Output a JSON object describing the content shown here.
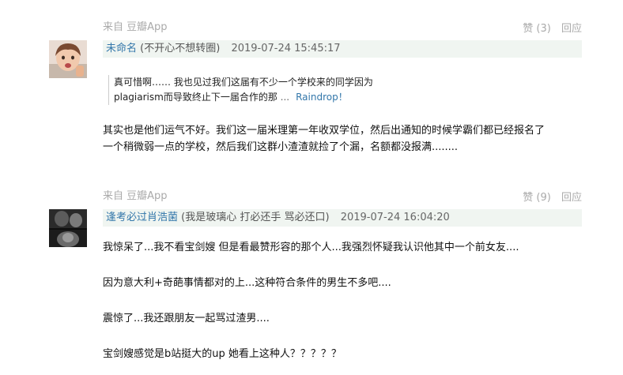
{
  "comments": [
    {
      "source": "来自 豆瓣App",
      "like_label": "赞 (3)",
      "reply_label": "回应",
      "author": "未命名",
      "author_sign": "(不开心不想转圈)",
      "time": "2019-07-24 15:45:17",
      "quote": {
        "line1": "真可惜啊…… 我也见过我们这届有不少一个学校来的同学因为",
        "line2": "plagiarism而导致终止下一届合作的那",
        "ellipsis": "...",
        "author": "Raindrop！"
      },
      "paragraphs": [
        "其实也是他们运气不好。我们这一届米理第一年收双学位，然后出通知的时候学霸们都已经报名了",
        "一个稍微弱一点的学校，然后我们这群小渣渣就捡了个漏，名额都没报满........"
      ]
    },
    {
      "source": "来自 豆瓣App",
      "like_label": "赞 (9)",
      "reply_label": "回应",
      "author": "逢考必过肖浩菌",
      "author_sign": "(我是玻璃心 打必还手 骂必还口)",
      "time": "2019-07-24 16:04:20",
      "paragraphs": [
        "我惊呆了...我不看宝剑嫂 但是看最赞形容的那个人...我强烈怀疑我认识他其中一个前女友....",
        "因为意大利+奇葩事情都对的上...这种符合条件的男生不多吧....",
        "震惊了...我还跟朋友一起骂过渣男....",
        "宝剑嫂感觉是b站挺大的up 她看上这种人？？？？？"
      ]
    }
  ],
  "colors": {
    "link": "#3377aa",
    "meta": "#aaaaaa",
    "header_bg": "#f0f5f1"
  }
}
